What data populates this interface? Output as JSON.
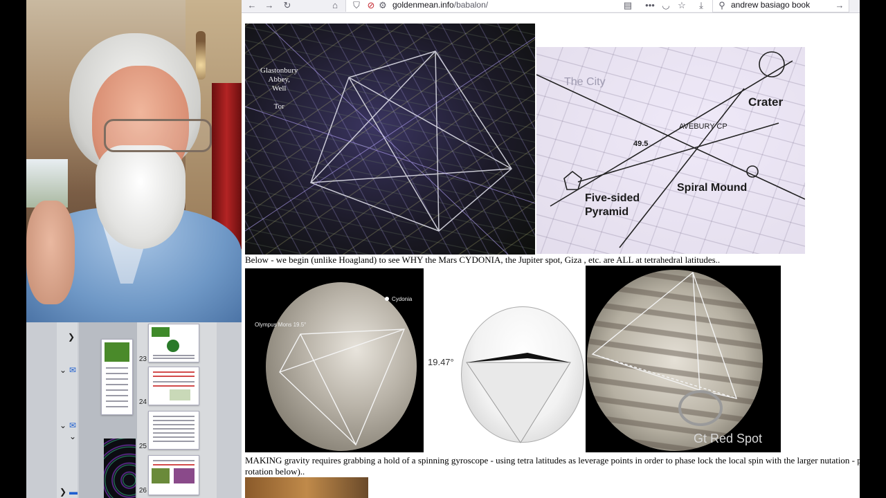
{
  "browser": {
    "url_domain": "goldenmean.info",
    "url_path": "/babalon/",
    "search_query": "andrew basiago book",
    "icons": {
      "back": "back-arrow-icon",
      "forward": "forward-arrow-icon",
      "reload": "reload-icon",
      "home": "home-icon",
      "shield": "tracking-shield-icon",
      "insecure": "insecure-lock-icon",
      "permissions": "permissions-icon",
      "reader": "reader-view-icon",
      "menu": "page-actions-menu-icon",
      "pocket": "pocket-icon",
      "bookmark": "bookmark-star-icon",
      "downloads": "downloads-icon",
      "search": "search-icon",
      "go": "go-arrow-icon"
    }
  },
  "page": {
    "image1_labels": "Glastonbury\nAbbey,\nWell\n\nTor",
    "image2_labels": {
      "city": "The City",
      "crater": "Crater",
      "avebury": "AVEBURY CP",
      "angle": "49.5",
      "spiral_mound": "Spiral Mound",
      "pyramid_line1": "Five-sided",
      "pyramid_line2": "Pyramid"
    },
    "caption1": "Below - we begin (unlike Hoagland) to see WHY the Mars CYDONIA, the Jupiter spot, Giza , etc. are ALL at tetrahedral latitudes..",
    "mars_labels": {
      "cydonia": "Cydonia",
      "olympus": "Olympus Mons  19.5°"
    },
    "tetra_angle": "19.47°",
    "jupiter_label": "Gt Red Spot",
    "caption2_line1": "MAKING gravity requires grabbing a hold of a spinning gyroscope - using tetra latitudes as leverage points in order to phase lock the local spin with the larger nutation - pro",
    "caption2_line2": "rotation below).."
  },
  "sidebar": {
    "page_numbers": [
      "23",
      "24",
      "25",
      "26"
    ]
  },
  "colors": {
    "toolbar_bg": "#f0f0f4",
    "page_bg": "#ffffff",
    "folder_blue": "#1f5fcf"
  }
}
